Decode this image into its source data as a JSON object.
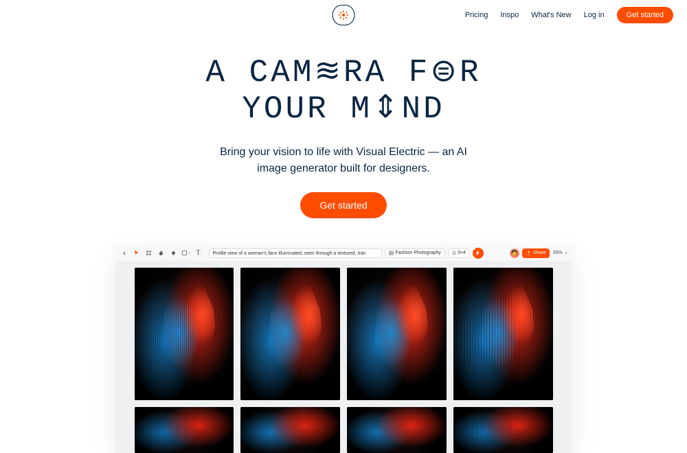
{
  "nav": {
    "pricing": "Pricing",
    "inspo": "Inspo",
    "whats_new": "What's New",
    "login": "Log in",
    "cta": "Get started"
  },
  "hero": {
    "title_line1": "A CAM≋RA F⊜R",
    "title_line2": "YOUR M⇕ND",
    "subtitle_line1": "Bring your vision to life with Visual Electric — an AI",
    "subtitle_line2": "image generator built for designers.",
    "cta": "Get started"
  },
  "app": {
    "prompt": "Profile view of a woman's face illuminated, seen through a textured, tran",
    "style": "Fashion Photography",
    "ratio": "3×4",
    "share": "Share",
    "zoom": "39%"
  },
  "colors": {
    "accent": "#ff4d00",
    "text": "#0a2540"
  }
}
